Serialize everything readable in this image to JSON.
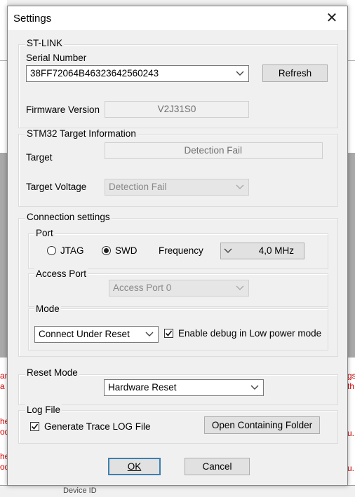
{
  "window": {
    "title": "Settings",
    "close_glyph": "✕"
  },
  "stlink": {
    "group_label": "ST-LINK",
    "serial_label": "Serial Number",
    "serial_value": "38FF72064B46323642560243",
    "refresh_label": "Refresh",
    "firmware_label": "Firmware Version",
    "firmware_value": "V2J31S0"
  },
  "target_info": {
    "group_label": "STM32 Target Information",
    "target_label": "Target",
    "target_value": "Detection Fail",
    "voltage_label": "Target Voltage",
    "voltage_value": "Detection Fail"
  },
  "connection": {
    "group_label": "Connection settings",
    "port_group_label": "Port",
    "jtag_label": "JTAG",
    "swd_label": "SWD",
    "selected_port": "SWD",
    "frequency_label": "Frequency",
    "frequency_value": "4,0 MHz",
    "access_port_label": "Access Port",
    "access_port_value": "Access Port 0",
    "mode_group_label": "Mode",
    "mode_value": "Connect Under Reset",
    "low_power_label": "Enable debug in Low power mode",
    "low_power_checked": true
  },
  "reset": {
    "group_label": "Reset Mode",
    "value": "Hardware Reset"
  },
  "log": {
    "group_label": "Log File",
    "trace_label": "Generate Trace LOG File",
    "trace_checked": true,
    "open_folder_label": "Open Containing Folder"
  },
  "actions": {
    "ok_label": "OK",
    "cancel_label": "Cancel"
  },
  "background": {
    "left_fragments": [
      "an",
      "a l",
      "he",
      "od",
      "he",
      "od"
    ],
    "right_fragments": [
      "gs",
      "th",
      "u.",
      "u."
    ],
    "bottom_fragment": "Device ID"
  },
  "colors": {
    "default_button_border": "#3c7fb1",
    "background_error_text": "#cc0000"
  }
}
